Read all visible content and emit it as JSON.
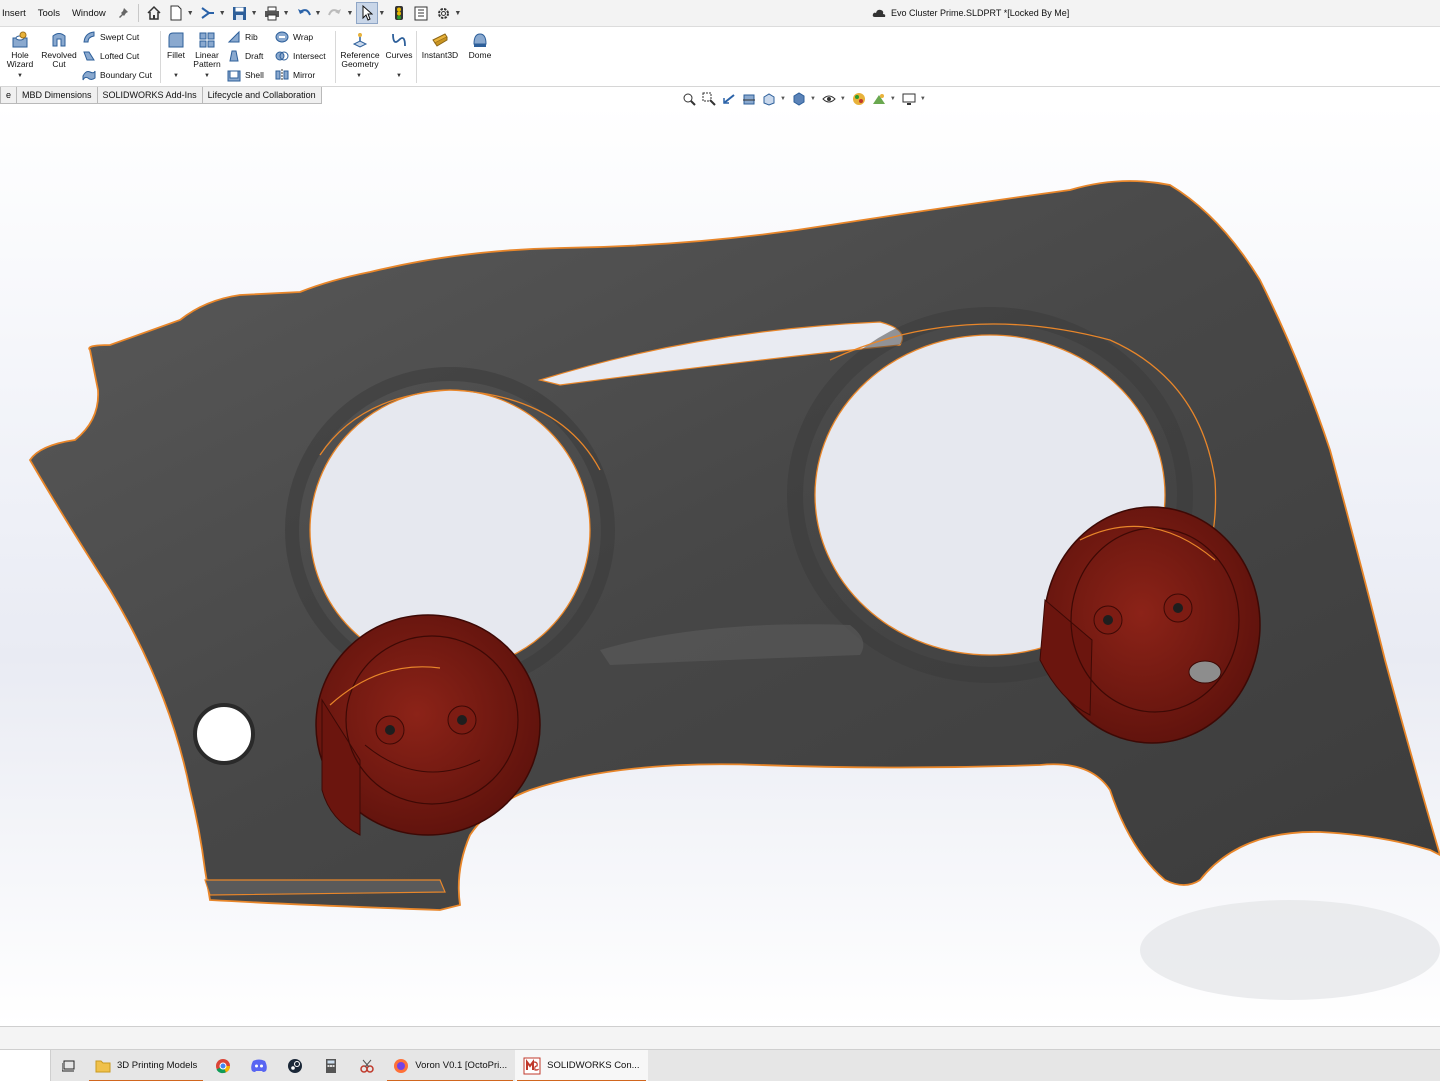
{
  "menu": {
    "items": [
      "Insert",
      "Tools",
      "Window"
    ],
    "document_title": "Evo Cluster Prime.SLDPRT *[Locked By Me]"
  },
  "ribbon": {
    "hole_wizard": "Hole\nWizard",
    "revolved_cut": "Revolved\nCut",
    "swept_cut": "Swept Cut",
    "lofted_cut": "Lofted Cut",
    "boundary_cut": "Boundary Cut",
    "fillet": "Fillet",
    "linear_pattern": "Linear\nPattern",
    "rib": "Rib",
    "draft": "Draft",
    "shell": "Shell",
    "wrap": "Wrap",
    "intersect": "Intersect",
    "mirror": "Mirror",
    "reference_geometry": "Reference\nGeometry",
    "curves": "Curves",
    "instant3d": "Instant3D",
    "dome": "Dome"
  },
  "tabs": [
    "e",
    "MBD Dimensions",
    "SOLIDWORKS Add-Ins",
    "Lifecycle and Collaboration"
  ],
  "taskbar": {
    "apps": [
      {
        "label": "3D Printing Models",
        "icon": "folder-icon"
      },
      {
        "label": "Voron V0.1 [OctoPri...",
        "icon": "firefox-icon"
      },
      {
        "label": "SOLIDWORKS Con...",
        "icon": "solidworks-icon"
      }
    ]
  },
  "colors": {
    "part_body": "#4a4a4a",
    "edge_highlight": "#e8862a",
    "component_red": "#7a1a14",
    "viewport_bg": "#eef0f7"
  }
}
